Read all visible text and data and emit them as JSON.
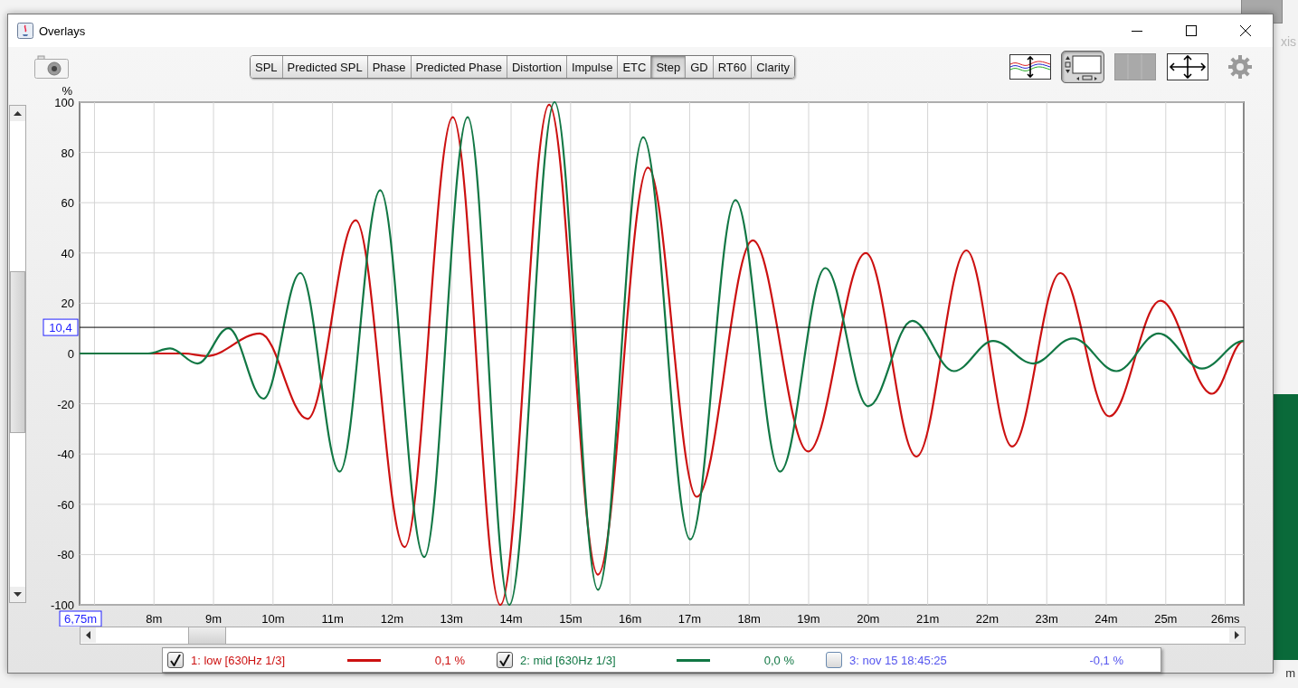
{
  "background": {
    "label": "xis",
    "corner_label": "m"
  },
  "window": {
    "title": "Overlays"
  },
  "tabs": [
    {
      "label": "SPL",
      "selected": false
    },
    {
      "label": "Predicted SPL",
      "selected": false
    },
    {
      "label": "Phase",
      "selected": false
    },
    {
      "label": "Predicted Phase",
      "selected": false
    },
    {
      "label": "Distortion",
      "selected": false
    },
    {
      "label": "Impulse",
      "selected": false
    },
    {
      "label": "ETC",
      "selected": false
    },
    {
      "label": "Step",
      "selected": true
    },
    {
      "label": "GD",
      "selected": false
    },
    {
      "label": "RT60",
      "selected": false
    },
    {
      "label": "Clarity",
      "selected": false
    }
  ],
  "toolbar_right": [
    {
      "kind": "traces",
      "pressed": false
    },
    {
      "kind": "layout",
      "pressed": true
    },
    {
      "kind": "blank",
      "pressed": false
    },
    {
      "kind": "move",
      "pressed": false
    },
    {
      "kind": "gear",
      "pressed": false
    }
  ],
  "chart": {
    "chart_data": {
      "type": "line",
      "ylabel": "%",
      "xlim": [
        6.75,
        26.31
      ],
      "ylim": [
        -100,
        100
      ],
      "xticks": [
        {
          "value": 8,
          "label": "8m"
        },
        {
          "value": 9,
          "label": "9m"
        },
        {
          "value": 10,
          "label": "10m"
        },
        {
          "value": 11,
          "label": "11m"
        },
        {
          "value": 12,
          "label": "12m"
        },
        {
          "value": 13,
          "label": "13m"
        },
        {
          "value": 14,
          "label": "14m"
        },
        {
          "value": 15,
          "label": "15m"
        },
        {
          "value": 16,
          "label": "16m"
        },
        {
          "value": 17,
          "label": "17m"
        },
        {
          "value": 18,
          "label": "18m"
        },
        {
          "value": 19,
          "label": "19m"
        },
        {
          "value": 20,
          "label": "20m"
        },
        {
          "value": 21,
          "label": "21m"
        },
        {
          "value": 22,
          "label": "22m"
        },
        {
          "value": 23,
          "label": "23m"
        },
        {
          "value": 24,
          "label": "24m"
        },
        {
          "value": 25,
          "label": "25m"
        },
        {
          "value": 26,
          "label": "26ms"
        }
      ],
      "yticks": [
        -100,
        -80,
        -60,
        -40,
        -20,
        0,
        20,
        40,
        60,
        80,
        100
      ],
      "x": [
        6.75,
        7.9,
        8.27,
        8.5,
        8.73,
        8.88,
        9.25,
        9.78,
        9.84,
        10.46,
        10.58,
        11.12,
        11.39,
        11.8,
        12.21,
        12.54,
        13.02,
        13.27,
        13.82,
        13.97,
        14.64,
        14.73,
        15.46,
        16.22,
        16.3,
        17.01,
        17.12,
        17.77,
        18.06,
        18.52,
        18.99,
        19.28,
        19.96,
        20.0,
        20.74,
        20.81,
        21.44,
        21.65,
        22.1,
        22.42,
        22.77,
        23.23,
        23.44,
        24.05,
        24.17,
        24.88,
        24.91,
        25.61,
        25.78,
        26.31
      ],
      "series": [
        {
          "color": "#cc1111",
          "values": [
            0,
            null,
            null,
            0,
            null,
            -1,
            null,
            8,
            null,
            null,
            -26,
            null,
            53,
            null,
            -77,
            null,
            94,
            null,
            -100,
            null,
            99,
            null,
            -88,
            null,
            74,
            null,
            -57,
            null,
            45,
            null,
            -39,
            null,
            40,
            null,
            null,
            -41,
            null,
            41,
            null,
            -37,
            null,
            32,
            null,
            -25,
            null,
            null,
            21,
            null,
            -16,
            5
          ]
        },
        {
          "color": "#117744",
          "values": [
            0,
            0,
            2,
            null,
            -4,
            null,
            10,
            null,
            -18,
            32,
            null,
            -47,
            null,
            65,
            null,
            -81,
            null,
            94,
            null,
            -100,
            null,
            100,
            -94,
            86,
            null,
            -74,
            null,
            61,
            null,
            -47,
            null,
            34,
            null,
            -21,
            13,
            null,
            -7,
            null,
            5,
            null,
            -4,
            null,
            6,
            null,
            -7,
            8,
            null,
            -6,
            null,
            5
          ]
        }
      ],
      "grid": true,
      "ref_lines": [
        {
          "axis": "y",
          "value": 10.4
        }
      ]
    },
    "y_readout": "10,4",
    "x_readout": "6,75m"
  },
  "legend": [
    {
      "label": "1: low [630Hz 1/3]",
      "value": "0,1 %",
      "checked": true,
      "color": "#cc1111"
    },
    {
      "label": "2: mid [630Hz 1/3]",
      "value": "0,0 %",
      "checked": true,
      "color": "#117744"
    },
    {
      "label": "3: nov 15 18:45:25",
      "value": "-0,1 %",
      "checked": false,
      "color": "#5555ee"
    }
  ]
}
